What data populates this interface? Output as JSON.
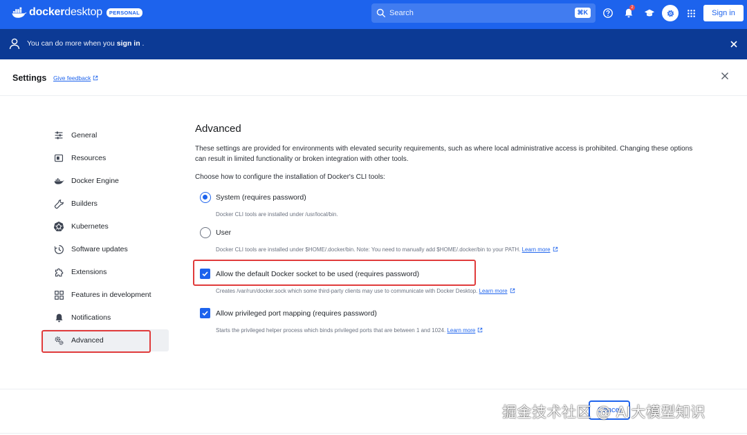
{
  "topbar": {
    "logo_word_a": "docker",
    "logo_word_b": "desktop",
    "plan_badge": "PERSONAL",
    "search_placeholder": "Search",
    "search_shortcut": "⌘K",
    "notification_count": "2",
    "sign_in_label": "Sign in",
    "brand_color": "#1d63ed"
  },
  "banner": {
    "text_prefix": "You can do more when you ",
    "text_link": "sign in",
    "text_suffix": " ."
  },
  "settings": {
    "title": "Settings",
    "feedback_label": "Give feedback"
  },
  "sidebar": {
    "items": [
      {
        "label": "General",
        "icon": "sliders-icon"
      },
      {
        "label": "Resources",
        "icon": "resources-icon"
      },
      {
        "label": "Docker Engine",
        "icon": "whale-icon"
      },
      {
        "label": "Builders",
        "icon": "wrench-icon"
      },
      {
        "label": "Kubernetes",
        "icon": "kubernetes-icon"
      },
      {
        "label": "Software updates",
        "icon": "clock-update-icon"
      },
      {
        "label": "Extensions",
        "icon": "puzzle-icon"
      },
      {
        "label": "Features in development",
        "icon": "grid-icon"
      },
      {
        "label": "Notifications",
        "icon": "bell-icon"
      },
      {
        "label": "Advanced",
        "icon": "gears-icon",
        "active": true
      }
    ]
  },
  "content": {
    "heading": "Advanced",
    "description": "These settings are provided for environments with elevated security requirements, such as where local administrative access is prohibited. Changing these options can result in limited functionality or broken integration with other tools.",
    "choose_label": "Choose how to configure the installation of Docker's CLI tools:",
    "option_system_label": "System (requires password)",
    "option_system_help": "Docker CLI tools are installed under /usr/local/bin.",
    "option_user_label": "User",
    "option_user_help": "Docker CLI tools are installed under $HOME/.docker/bin. Note: You need to manually add $HOME/.docker/bin to your PATH.",
    "socket_label": "Allow the default Docker socket to be used (requires password)",
    "socket_help": "Creates /var/run/docker.sock which some third-party clients may use to communicate with Docker Desktop.",
    "port_label": "Allow privileged port mapping (requires password)",
    "port_help": "Starts the privileged helper process which binds privileged ports that are between 1 and 1024.",
    "learn_more": "Learn more"
  },
  "footer": {
    "cancel_label": "Cancel"
  },
  "watermark": "掘金技术社区 @ AI大模型知识"
}
